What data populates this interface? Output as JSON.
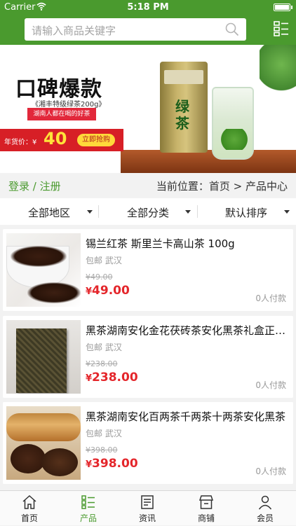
{
  "status_bar": {
    "carrier": "Carrier",
    "time": "5:18 PM"
  },
  "search": {
    "placeholder": "请输入商品关键字"
  },
  "banner": {
    "headline": "口碑爆款",
    "subtitle": "《湘丰特级绿茶200g》",
    "tagline": "湖南人都在喝的好茶",
    "price_label": "年货价：¥",
    "price": "40",
    "cta": "立即抢购",
    "package_text": "绿茶"
  },
  "auth": {
    "login": "登录 / 注册"
  },
  "breadcrumb": "当前位置：首页 > 产品中心",
  "filters": [
    {
      "label": "全部地区"
    },
    {
      "label": "全部分类"
    },
    {
      "label": "默认排序"
    }
  ],
  "products": [
    {
      "title": "锡兰红茶 斯里兰卡高山茶 100g",
      "shipping": "包邮",
      "city": "武汉",
      "old_price": "¥49.00",
      "price_symbol": "¥",
      "price": "49.00",
      "sold": "0人付款"
    },
    {
      "title": "黑茶湖南安化金花茯砖茶安化黑茶礼盒正宗安化黑茶",
      "shipping": "包邮",
      "city": "武汉",
      "old_price": "¥238.00",
      "price_symbol": "¥",
      "price": "238.00",
      "sold": "0人付款"
    },
    {
      "title": "黑茶湖南安化百两茶千两茶十两茶安化黑茶",
      "shipping": "包邮",
      "city": "武汉",
      "old_price": "¥398.00",
      "price_symbol": "¥",
      "price": "398.00",
      "sold": "0人付款"
    }
  ],
  "tabbar": [
    {
      "label": "首页",
      "icon": "home-icon"
    },
    {
      "label": "产品",
      "icon": "product-list-icon",
      "active": true
    },
    {
      "label": "资讯",
      "icon": "news-icon"
    },
    {
      "label": "商铺",
      "icon": "store-icon"
    },
    {
      "label": "会员",
      "icon": "member-icon"
    }
  ],
  "colors": {
    "brand_green": "#4a9a2e",
    "price_red": "#e4262b"
  }
}
